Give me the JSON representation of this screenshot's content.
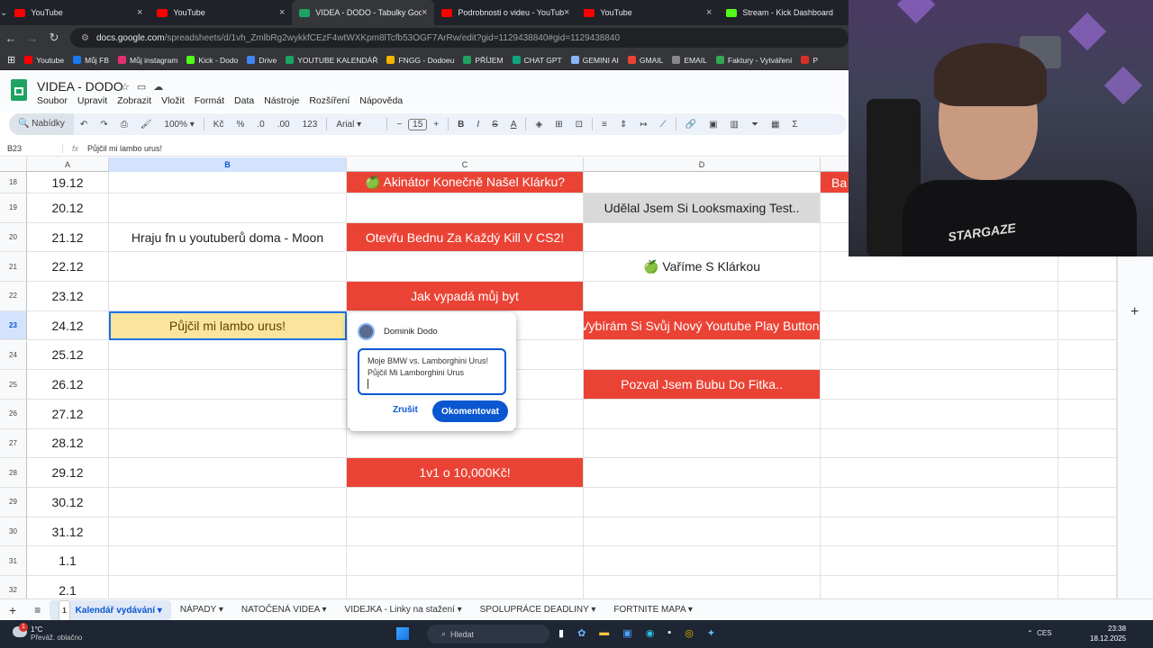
{
  "browser": {
    "tabs": [
      {
        "label": "YouTube",
        "color": "#ff0000",
        "active": false
      },
      {
        "label": "YouTube",
        "color": "#ff0000",
        "active": false
      },
      {
        "label": "VIDEA - DODO - Tabulky Goog",
        "color": "#1ea362",
        "active": true
      },
      {
        "label": "Podrobnosti o videu - YouTube",
        "color": "#ff0000",
        "active": false
      },
      {
        "label": "YouTube",
        "color": "#ff0000",
        "active": false
      },
      {
        "label": "Stream - Kick Dashboard",
        "color": "#53fc18",
        "active": false
      }
    ],
    "url_host": "docs.google.com",
    "url_path": "/spreadsheets/d/1vh_ZmlbRg2wykkfCEzF4wtWXKpm8lTcfb53OGF7ArRw/edit?gid=1129438840#gid=1129438840",
    "bookmarks": [
      "Youtube",
      "Můj FB",
      "Můj instagram",
      "Kick - Dodo",
      "Drive",
      "YOUTUBE KALENDÁŘ",
      "FNGG - Dodoeu",
      "PŘÍJEM",
      "CHAT GPT",
      "GEMINI AI",
      "GMAIL",
      "EMAIL",
      "Faktury - Vytváření",
      "P"
    ]
  },
  "sheets": {
    "doc_title": "VIDEA - DODO",
    "menus": [
      "Soubor",
      "Upravit",
      "Zobrazit",
      "Vložit",
      "Formát",
      "Data",
      "Nástroje",
      "Rozšíření",
      "Nápověda"
    ],
    "toolbar": {
      "search_label": "Nabídky",
      "zoom": "100%",
      "currency": "Kč",
      "percent": "%",
      "dec_minus": ".0",
      "dec_plus": ".00",
      "format123": "123",
      "font": "Arial",
      "font_size": "15"
    },
    "name_box": "B23",
    "formula": "Půjčil mi lambo urus!",
    "columns": [
      "A",
      "B",
      "C",
      "D"
    ],
    "rows": [
      {
        "n": "18",
        "a": "19.12",
        "b": "",
        "c": "🍏 Akinátor Konečně Našel Klárku?",
        "d": "",
        "e": "Ba"
      },
      {
        "n": "19",
        "a": "20.12",
        "b": "",
        "c": "",
        "d": "Udělal Jsem Si Looksmaxing Test..",
        "e": ""
      },
      {
        "n": "20",
        "a": "21.12",
        "b": "Hraju fn u youtuberů doma - Moon",
        "c": "Otevřu Bednu Za Každý Kill V CS2!",
        "d": "",
        "e": ""
      },
      {
        "n": "21",
        "a": "22.12",
        "b": "",
        "c": "",
        "d": "🍏 Vaříme S Klárkou",
        "e": ""
      },
      {
        "n": "22",
        "a": "23.12",
        "b": "",
        "c": "Jak vypadá můj byt",
        "d": "",
        "e": ""
      },
      {
        "n": "23",
        "a": "24.12",
        "b": "Půjčil mi lambo urus!",
        "c": "",
        "d": "Vybírám Si Svůj Nový Youtube Play Button!",
        "e": ""
      },
      {
        "n": "24",
        "a": "25.12",
        "b": "",
        "c": "",
        "d": "",
        "e": ""
      },
      {
        "n": "25",
        "a": "26.12",
        "b": "",
        "c": "",
        "d": "Pozval Jsem Bubu Do Fitka..",
        "e": ""
      },
      {
        "n": "26",
        "a": "27.12",
        "b": "",
        "c": "",
        "d": "",
        "e": ""
      },
      {
        "n": "27",
        "a": "28.12",
        "b": "",
        "c": "",
        "d": "",
        "e": ""
      },
      {
        "n": "28",
        "a": "29.12",
        "b": "",
        "c": "1v1 o 10,000Kč!",
        "d": "",
        "e": ""
      },
      {
        "n": "29",
        "a": "30.12",
        "b": "",
        "c": "",
        "d": "",
        "e": ""
      },
      {
        "n": "30",
        "a": "31.12",
        "b": "",
        "c": "",
        "d": "",
        "e": ""
      },
      {
        "n": "31",
        "a": "1.1",
        "b": "",
        "c": "",
        "d": "",
        "e": ""
      },
      {
        "n": "32",
        "a": "2.1",
        "b": "",
        "c": "",
        "d": "",
        "e": ""
      }
    ],
    "comment": {
      "author": "Dominik Dodo",
      "line1": "Moje BMW vs. Lamborghini Urus!",
      "line2": "Půjčil Mi Lamborghini Urus",
      "cancel": "Zrušit",
      "submit": "Okomentovat"
    },
    "sheet_tabs": [
      "Kalendář vydávání",
      "NÁPADY",
      "NATOČENÁ VIDEA",
      "VIDEJKA - Linky na stažení",
      "SPOLUPRÁCE DEADLINY",
      "FORTNITE MAPA"
    ],
    "active_tab_badge": "1"
  },
  "taskbar": {
    "temp": "1°C",
    "weather": "Převáž. oblačno",
    "notif_count": "1",
    "search": "Hledat",
    "lang": "CES",
    "time": "23:38",
    "date": "18.12.2025"
  },
  "webcam": {
    "shirt_text": "STARGAZE"
  }
}
